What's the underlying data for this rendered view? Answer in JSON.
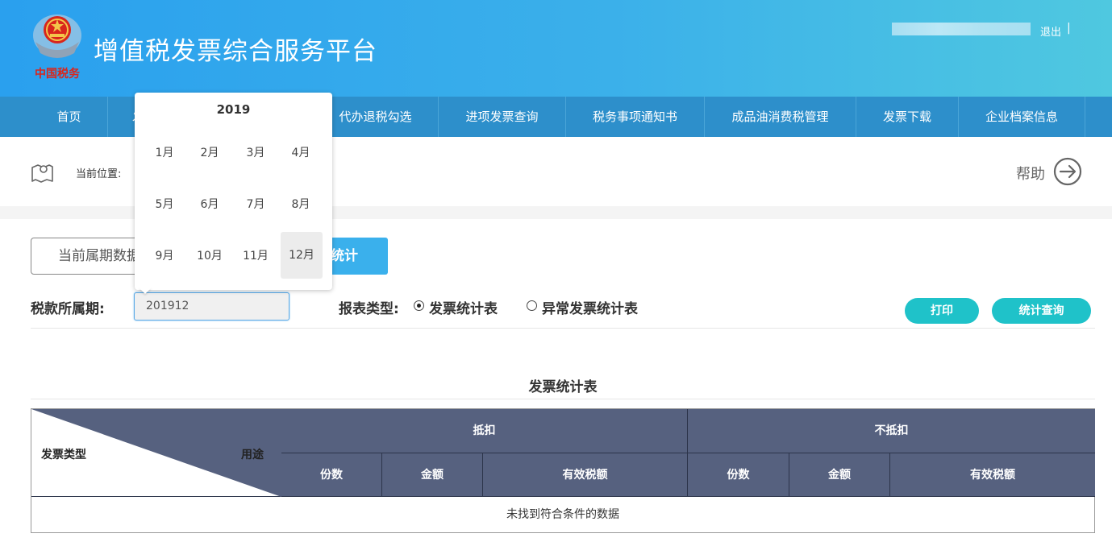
{
  "header": {
    "app_title": "增值税发票综合服务平台",
    "logo_text": "中国税务",
    "logout": "退出",
    "separator": "|"
  },
  "nav": {
    "items": [
      "首页",
      "代办退税勾选",
      "进项发票查询",
      "税务事项通知书",
      "成品油消费税管理",
      "发票下载",
      "企业档案信息"
    ],
    "hidden_first_char": "发"
  },
  "location": {
    "label": "当前位置:",
    "help": "帮助"
  },
  "tabs": {
    "current": "当前属期数据",
    "stat": "统计"
  },
  "query": {
    "period_label": "税款所属期:",
    "period_value": "201912",
    "report_type_label": "报表类型:",
    "options": [
      {
        "label": "发票统计表",
        "checked": true
      },
      {
        "label": "异常发票统计表",
        "checked": false
      }
    ],
    "print_button": "打印",
    "query_button": "统计查询"
  },
  "table": {
    "title": "发票统计表",
    "corner_left": "发票类型",
    "corner_right": "用途",
    "groups": [
      "抵扣",
      "不抵扣"
    ],
    "columns": [
      "份数",
      "金额",
      "有效税额",
      "份数",
      "金额",
      "有效税额"
    ],
    "empty_message": "未找到符合条件的数据"
  },
  "picker": {
    "year": "2019",
    "months": [
      "1月",
      "2月",
      "3月",
      "4月",
      "5月",
      "6月",
      "7月",
      "8月",
      "9月",
      "10月",
      "11月",
      "12月"
    ],
    "selected_index": 11
  },
  "colors": {
    "header_start": "#2aa0ee",
    "header_end": "#4fc8e0",
    "nav": "#2d8fcb",
    "table_header": "#56617f",
    "pill": "#1fc2c9",
    "stat_tab": "#3ab0ec"
  }
}
